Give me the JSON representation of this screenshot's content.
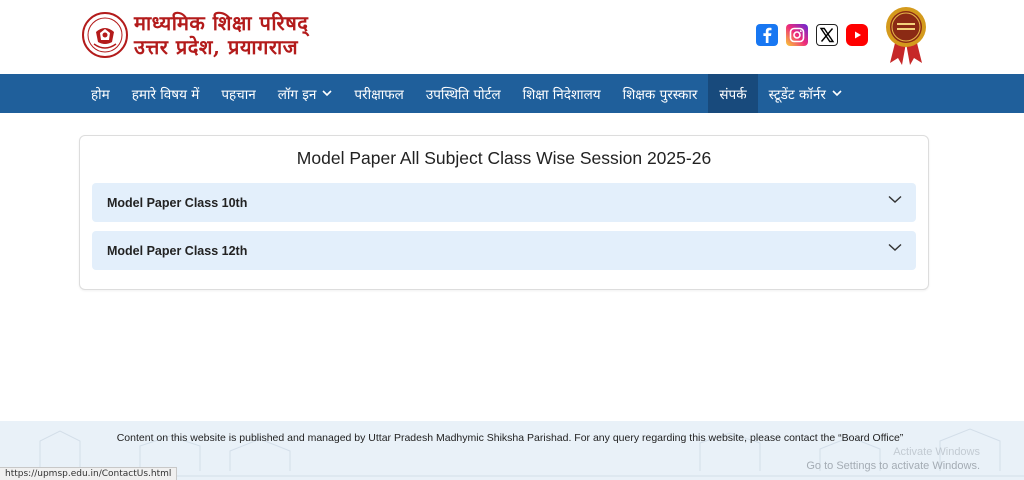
{
  "header": {
    "brand_line1": "माध्यमिक शिक्षा परिषद्",
    "brand_line2": "उत्तर प्रदेश, प्रयागराज",
    "social": [
      {
        "icon": "facebook-icon",
        "color": "#1877f2"
      },
      {
        "icon": "instagram-icon",
        "color": "#d6249f"
      },
      {
        "icon": "x-icon",
        "color": "#000000"
      },
      {
        "icon": "youtube-icon",
        "color": "#ff0000"
      }
    ],
    "medal_icon": "award-medal-icon"
  },
  "nav": {
    "items": [
      {
        "label": "होम",
        "dropdown": false
      },
      {
        "label": "हमारे विषय में",
        "dropdown": false
      },
      {
        "label": "पहचान",
        "dropdown": false
      },
      {
        "label": "लॉग इन",
        "dropdown": true
      },
      {
        "label": "परीक्षाफल",
        "dropdown": false
      },
      {
        "label": "उपस्थिति पोर्टल",
        "dropdown": false
      },
      {
        "label": "शिक्षा निदेशालय",
        "dropdown": false
      },
      {
        "label": "शिक्षक पुरस्कार",
        "dropdown": false
      },
      {
        "label": "संपर्क",
        "dropdown": false,
        "active": true
      },
      {
        "label": "स्टूडेंट कॉर्नर",
        "dropdown": true
      }
    ]
  },
  "main": {
    "title": "Model Paper All Subject Class Wise Session 2025-26",
    "accordion": [
      {
        "label": "Model Paper Class 10th"
      },
      {
        "label": "Model Paper Class 12th"
      }
    ]
  },
  "footer": {
    "text": "Content on this website is published and managed by Uttar Pradesh Madhymic Shiksha Parishad. For any query regarding this website, please contact the “Board Office”",
    "watermark_line1": "Activate Windows",
    "watermark_line2": "Go to Settings to activate Windows."
  },
  "status_bar": {
    "url": "https://upmsp.edu.in/ContactUs.html"
  },
  "colors": {
    "nav_bg": "#1f5f9b",
    "nav_active": "#184a7c",
    "brand_red": "#b31b1b",
    "accordion_bg": "#e3effb"
  }
}
